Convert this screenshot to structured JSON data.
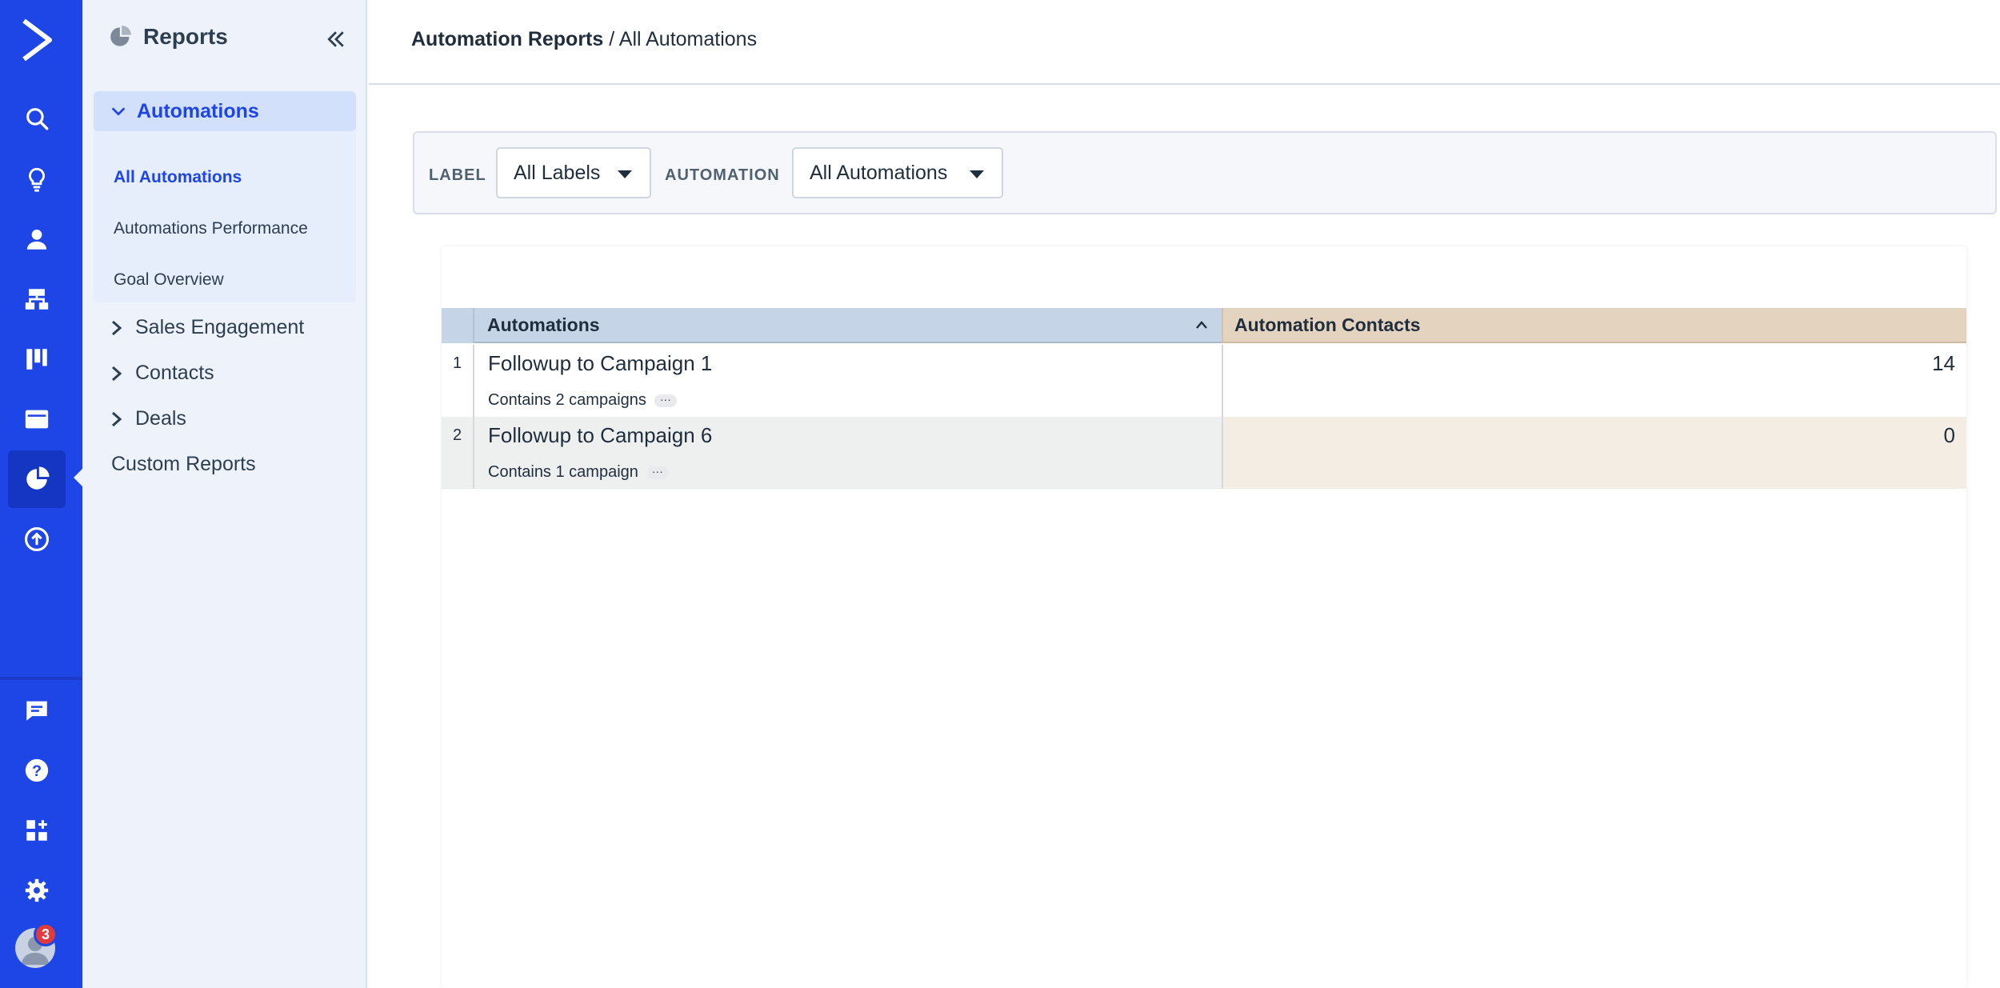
{
  "sidebar": {
    "title": "Reports",
    "group": {
      "label": "Automations",
      "items": [
        {
          "label": "All Automations",
          "active": true
        },
        {
          "label": "Automations Performance"
        },
        {
          "label": "Goal Overview"
        }
      ]
    },
    "nav": [
      {
        "label": "Sales Engagement"
      },
      {
        "label": "Contacts"
      },
      {
        "label": "Deals"
      },
      {
        "label": "Custom Reports"
      }
    ]
  },
  "breadcrumb": {
    "parent": "Automation Reports",
    "separator": "/",
    "current": "All Automations"
  },
  "filters": {
    "label_title": "LABEL",
    "label_value": "All Labels",
    "automation_title": "AUTOMATION",
    "automation_value": "All Automations"
  },
  "table": {
    "columns": [
      "Automations",
      "Automation Contacts"
    ],
    "rows": [
      {
        "index": "1",
        "name": "Followup to Campaign 1",
        "meta": "Contains 2 campaigns",
        "contacts": "14"
      },
      {
        "index": "2",
        "name": "Followup to Campaign 6",
        "meta": "Contains 1 campaign",
        "contacts": "0"
      }
    ]
  },
  "notifications": {
    "count": "3"
  },
  "colors": {
    "brand": "#1e45e6",
    "badge": "#e23b3b"
  }
}
